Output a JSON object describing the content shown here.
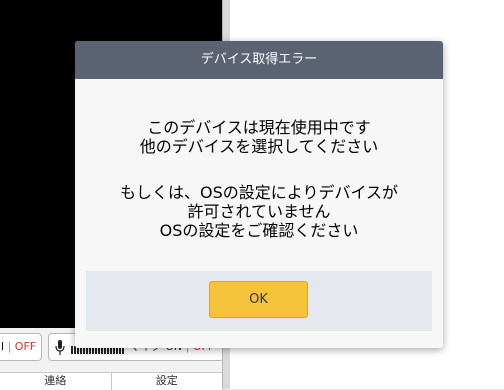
{
  "background": {
    "camera_toggle": {
      "suffix": "l",
      "sep": "|",
      "off_label": "OFF"
    },
    "mic_toggle": {
      "label": "マイク ON",
      "sep": "|",
      "off_label": "OFF"
    },
    "tabs": [
      {
        "label": "連絡"
      },
      {
        "label": "設定"
      }
    ]
  },
  "dialog": {
    "title": "デバイス取得エラー",
    "message1": [
      "このデバイスは現在使用中です",
      "他のデバイスを選択してください"
    ],
    "message2": [
      "もしくは、OSの設定によりデバイスが",
      "許可されていません",
      "OSの設定をご確認ください"
    ],
    "ok_label": "OK"
  },
  "colors": {
    "header_bg": "#5b6372",
    "button_bg": "#f5c33b",
    "footer_bg": "#e6e8ef",
    "off_red": "#e0302c"
  }
}
